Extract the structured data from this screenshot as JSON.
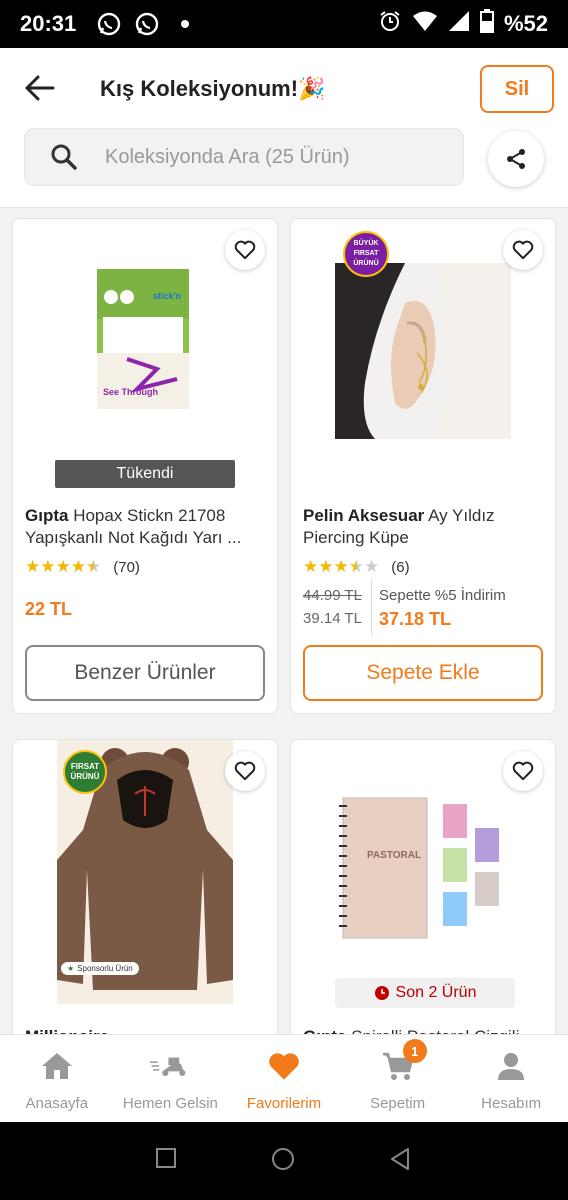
{
  "status_bar": {
    "time": "20:31",
    "battery": "%52"
  },
  "header": {
    "title": "Kış Koleksiyonum!🎉",
    "delete_label": "Sil",
    "search_placeholder": "Koleksiyonda Ara (25 Ürün)"
  },
  "products": [
    {
      "brand": "Gıpta",
      "name": "Hopax Stickn 21708 Yapışkanlı Not Kağıdı Yarı ...",
      "rating": 4.5,
      "review_count": "(70)",
      "price": "22 TL",
      "stock_label": "Tükendi",
      "button_label": "Benzer Ürünler",
      "image_texts": {
        "logo": "stick'n",
        "title": "See Through"
      }
    },
    {
      "brand": "Pelin Aksesuar",
      "name": "Ay Yıldız Piercing Küpe",
      "rating": 3.5,
      "review_count": "(6)",
      "old_price": "44.99 TL",
      "price": "39.14 TL",
      "basket_discount_label": "Sepette %5 İndirim",
      "basket_price": "37.18 TL",
      "badge": "BÜYÜK FIRSAT ÜRÜNÜ",
      "button_label": "Sepete Ekle"
    },
    {
      "brand": "Millionaire",
      "badge": "FIRSAT ÜRÜNÜ",
      "sponsored_label": "Sponsorlu Ürün"
    },
    {
      "brand": "Gıpta",
      "name": "Spiralli Pastoral Çizgili",
      "stock_label": "Son 2 Ürün",
      "image_texts": {
        "cover": "PASTORAL"
      }
    }
  ],
  "bottom_nav": [
    {
      "label": "Anasayfa",
      "icon": "home-icon",
      "active": false
    },
    {
      "label": "Hemen Gelsin",
      "icon": "scooter-icon",
      "active": false
    },
    {
      "label": "Favorilerim",
      "icon": "heart-icon",
      "active": true
    },
    {
      "label": "Sepetim",
      "icon": "cart-icon",
      "active": false,
      "badge": "1"
    },
    {
      "label": "Hesabım",
      "icon": "user-icon",
      "active": false
    }
  ],
  "colors": {
    "accent": "#f27a1a",
    "star": "#f5b800",
    "danger": "#c00000"
  }
}
